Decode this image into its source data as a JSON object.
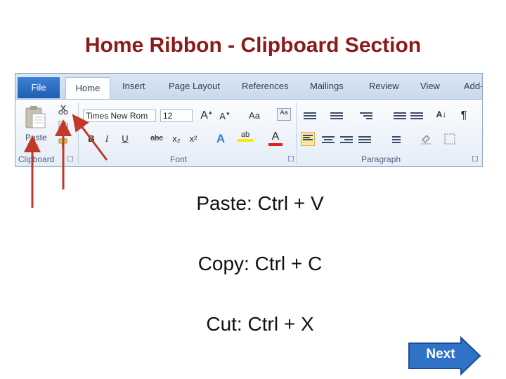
{
  "slide": {
    "title": "Home Ribbon - Clipboard Section",
    "shortcuts": [
      {
        "text": "Paste: Ctrl + V"
      },
      {
        "text": "Copy: Ctrl + C"
      },
      {
        "text": "Cut: Ctrl + X"
      }
    ],
    "next_label": "Next"
  },
  "ribbon": {
    "tabs": [
      "File",
      "Home",
      "Insert",
      "Page Layout",
      "References",
      "Mailings",
      "Review",
      "View",
      "Add-"
    ],
    "active_tab": "Home",
    "clipboard": {
      "label": "Clipboard",
      "paste_label": "Paste"
    },
    "font": {
      "label": "Font",
      "font_name": "Times New Rom",
      "font_size": "12",
      "buttons": [
        "B",
        "I",
        "U",
        "abc",
        "x₂",
        "x²"
      ]
    },
    "paragraph": {
      "label": "Paragraph",
      "pilcrow": "¶"
    }
  },
  "colors": {
    "title": "#8b1a1a",
    "arrow": "#c0392b",
    "next_button": "#2f72c8"
  },
  "icons": [
    "paste-icon",
    "cut-icon",
    "copy-icon",
    "format-painter-icon",
    "next-arrow-icon"
  ]
}
